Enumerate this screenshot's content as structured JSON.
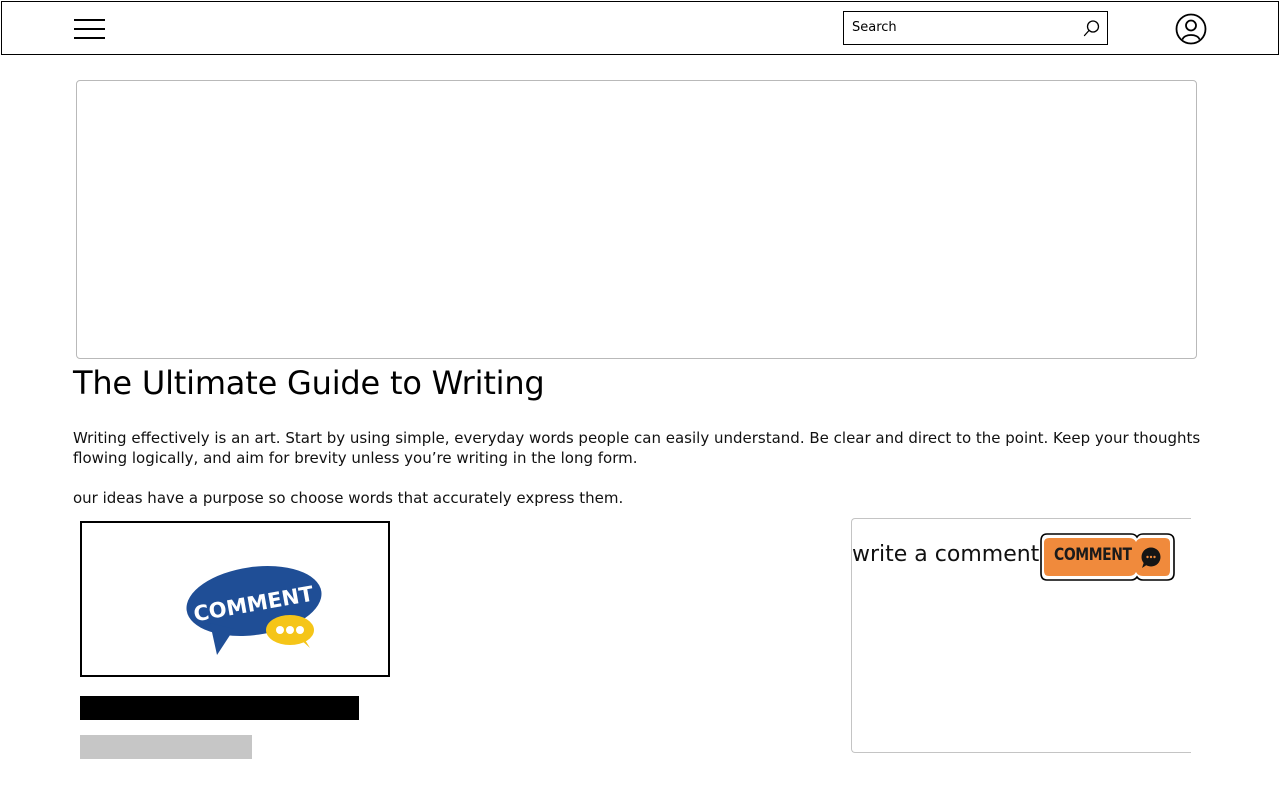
{
  "header": {
    "search": {
      "placeholder": "Search",
      "value": ""
    }
  },
  "article": {
    "title": "The Ultimate Guide to Writing",
    "paragraphs": [
      "Writing effectively is an art. Start by using simple, everyday words people can easily understand. Be clear and direct to the point. Keep your thoughts flowing logically, and aim for brevity unless you’re writing in the long form.",
      "our ideas have a purpose so choose words that accurately express them."
    ],
    "image_card": {
      "logo_text": "COMMENT"
    }
  },
  "comments": {
    "prompt": "write a comment",
    "button_label": "COMMENT",
    "button_color": "#F08A3C"
  },
  "colors": {
    "logo_blue": "#1F4E96",
    "logo_yellow": "#F5C518",
    "grey_bar": "#C6C6C6"
  }
}
